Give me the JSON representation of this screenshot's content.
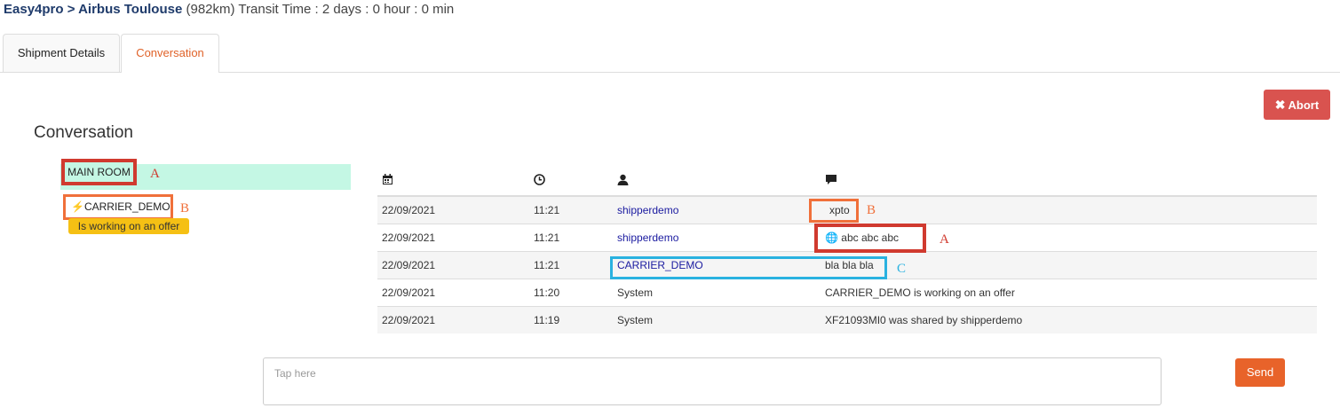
{
  "header": {
    "route": "Easy4pro > Airbus Toulouse",
    "distance": "(982km)",
    "transit": "Transit Time : 2 days : 0 hour : 0 min"
  },
  "tabs": [
    {
      "label": "Shipment Details",
      "active": false
    },
    {
      "label": "Conversation",
      "active": true
    }
  ],
  "abort_label": "Abort",
  "conversation_title": "Conversation",
  "rooms": {
    "main_room": "MAIN ROOM",
    "carrier": "CARRIER_DEMO",
    "carrier_status": "Is working on an offer"
  },
  "annotations": {
    "main_room": "A",
    "carrier": "B",
    "xpto": "B",
    "abc": "A",
    "carrier_user": "C"
  },
  "table": {
    "columns": [
      "calendar-icon",
      "clock-icon",
      "user-icon",
      "comment-icon"
    ],
    "rows": [
      {
        "date": "22/09/2021",
        "time": "11:21",
        "user": "shipperdemo",
        "message": "xpto"
      },
      {
        "date": "22/09/2021",
        "time": "11:21",
        "user": "shipperdemo",
        "message": "abc abc abc"
      },
      {
        "date": "22/09/2021",
        "time": "11:21",
        "user": "CARRIER_DEMO",
        "message": "bla bla bla"
      },
      {
        "date": "22/09/2021",
        "time": "11:20",
        "user": "System",
        "message": "CARRIER_DEMO is working on an offer"
      },
      {
        "date": "22/09/2021",
        "time": "11:19",
        "user": "System",
        "message": "XF21093MI0 was shared by shipperdemo"
      }
    ]
  },
  "input": {
    "placeholder": "Tap here"
  },
  "send_label": "Send",
  "colors": {
    "abort": "#d9534f",
    "send": "#e8632a",
    "active_tab": "#e0632a",
    "room_highlight": "#c4f7e4",
    "status_badge": "#f5c014",
    "annotation_red": "#d03a2f",
    "annotation_orange": "#f0703a",
    "annotation_cyan": "#2ab2e0"
  }
}
